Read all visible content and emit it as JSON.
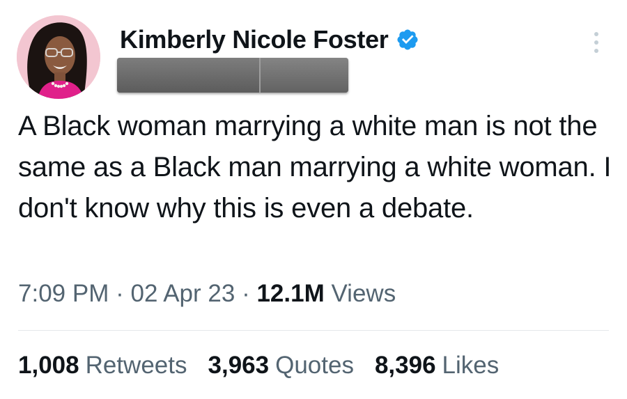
{
  "author": {
    "display_name": "Kimberly Nicole Foster",
    "verified_badge_icon": "verified-badge-icon",
    "handle_redacted": true
  },
  "tweet": {
    "text": "A Black woman marrying a white man is not the same as a Black man marrying a white woman. I don't know why this is even a debate.",
    "time": "7:09 PM",
    "separator": "·",
    "date": "02 Apr 23",
    "views_count": "12.1M",
    "views_label": "Views"
  },
  "stats": {
    "retweets_count": "1,008",
    "retweets_label": "Retweets",
    "quotes_count": "3,963",
    "quotes_label": "Quotes",
    "likes_count": "8,396",
    "likes_label": "Likes"
  },
  "colors": {
    "verified": "#1d9bf0",
    "text_primary": "#0f1419",
    "text_secondary": "#536471",
    "divider": "#e4e8eb"
  },
  "icons": [
    "verified-badge-icon",
    "more-options-icon"
  ]
}
